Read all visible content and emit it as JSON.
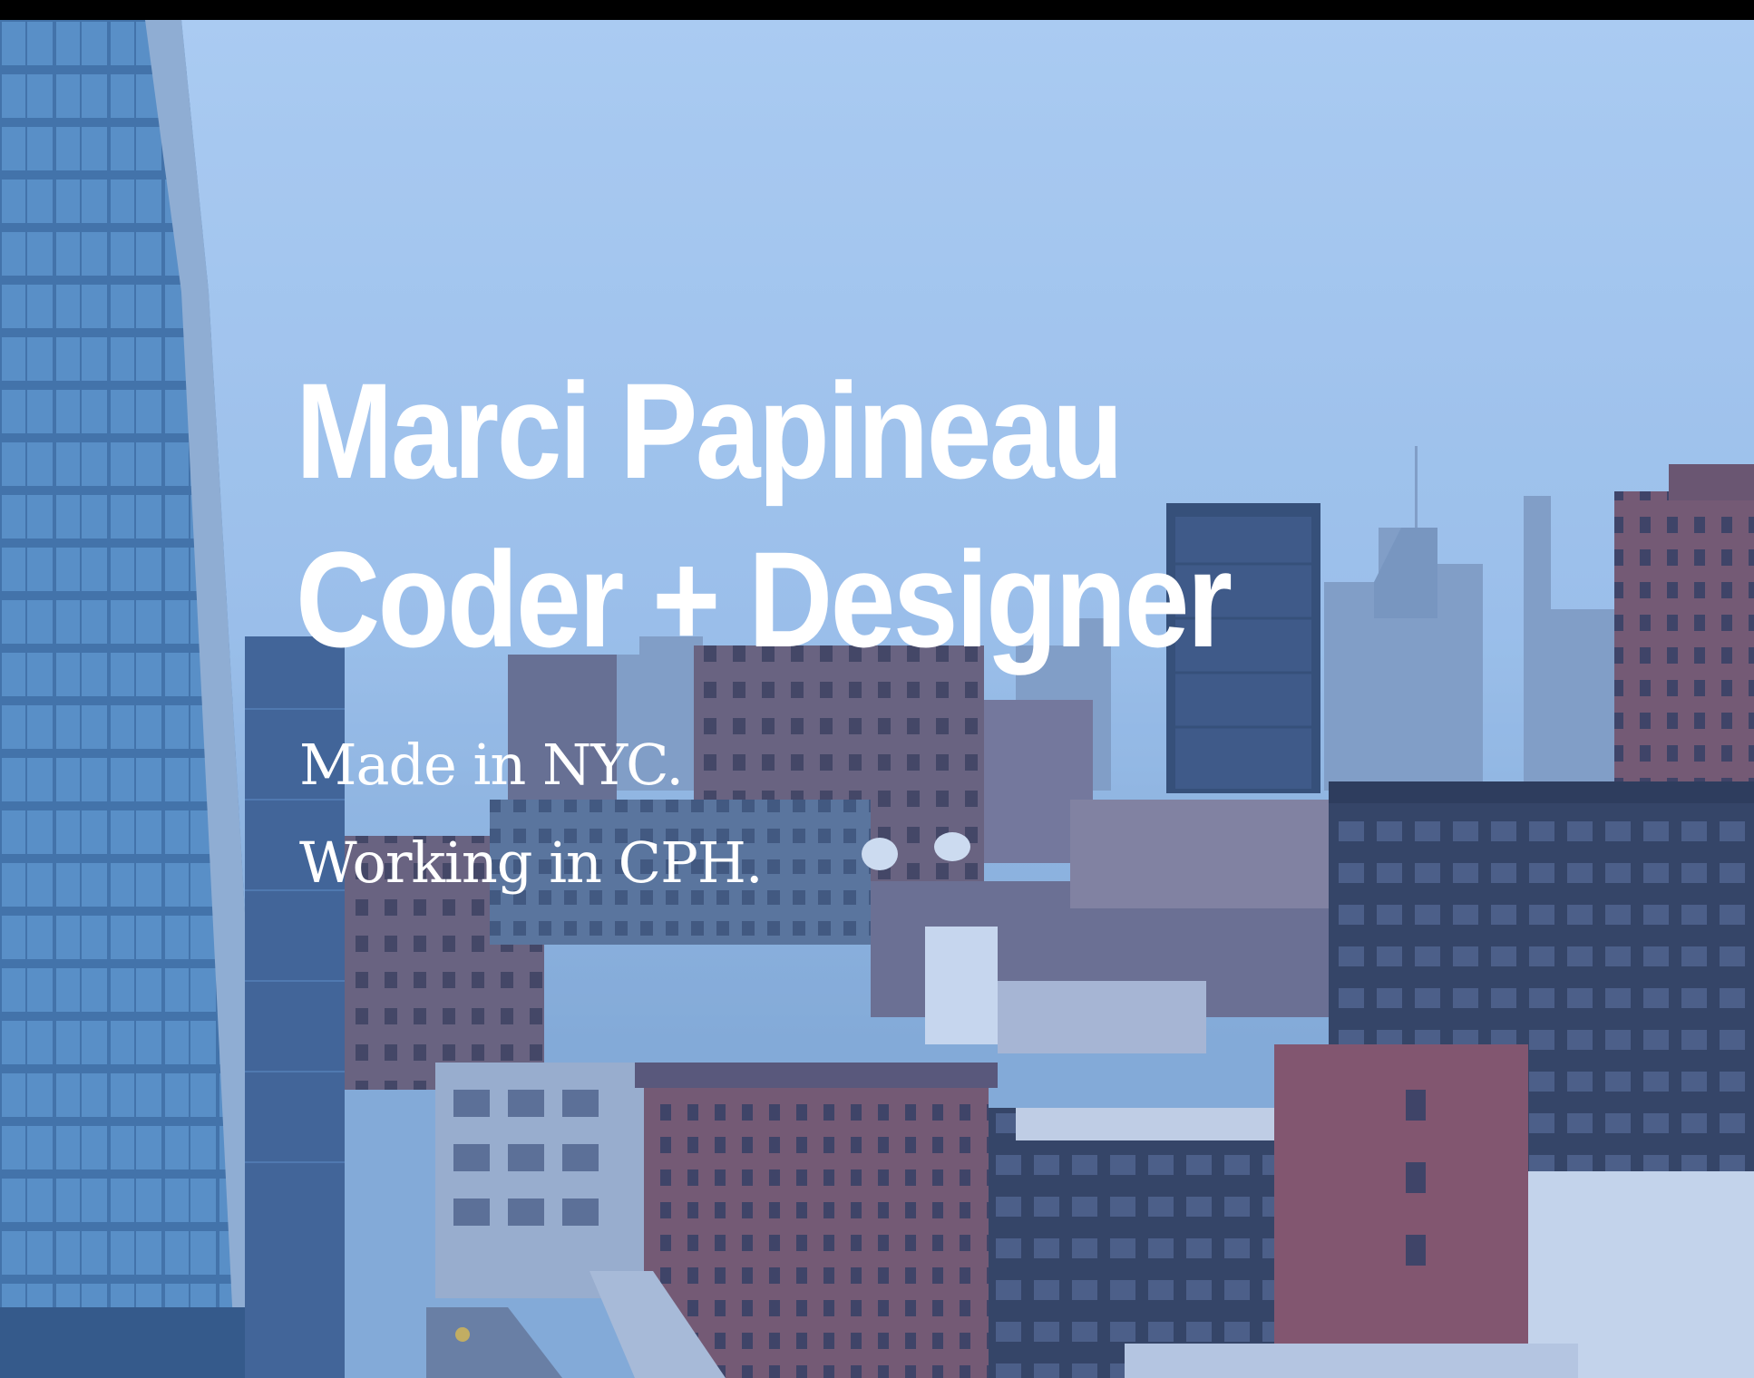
{
  "hero": {
    "background": "city-skyline-photo",
    "tint_color": "#6aa0e0",
    "name": "Marci Papineau",
    "role": "Coder + Designer",
    "tagline_1": "Made in NYC.",
    "tagline_2": "Working in CPH."
  }
}
